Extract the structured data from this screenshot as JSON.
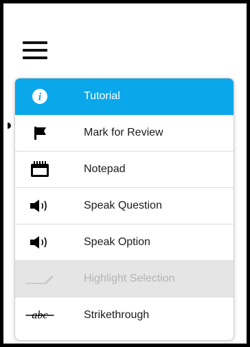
{
  "menu": {
    "items": [
      {
        "label": "Tutorial",
        "icon": "info-icon",
        "state": "active"
      },
      {
        "label": "Mark for Review",
        "icon": "flag-icon",
        "state": "normal"
      },
      {
        "label": "Notepad",
        "icon": "notepad-icon",
        "state": "normal"
      },
      {
        "label": "Speak Question",
        "icon": "speaker-icon",
        "state": "normal"
      },
      {
        "label": "Speak Option",
        "icon": "speaker-icon",
        "state": "normal"
      },
      {
        "label": "Highlight Selection",
        "icon": "highlighter-icon",
        "state": "disabled"
      },
      {
        "label": "Strikethrough",
        "icon": "strikethrough-icon",
        "state": "normal"
      }
    ]
  },
  "colors": {
    "active_bg": "#0aa7ea",
    "disabled_bg": "#e5e5e5",
    "disabled_text": "#b3b3b3",
    "border": "#000000"
  }
}
